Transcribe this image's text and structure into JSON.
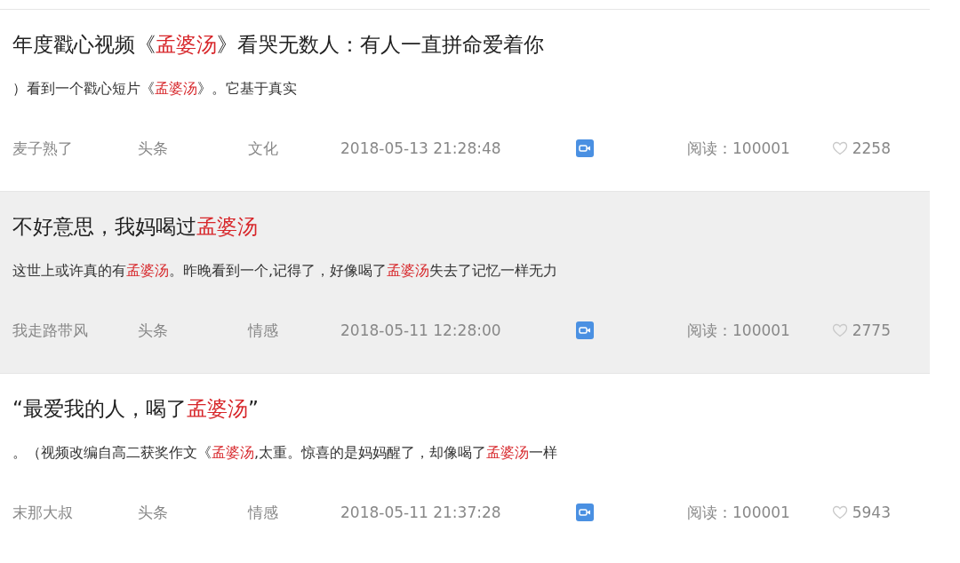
{
  "articles": [
    {
      "highlighted": false,
      "title": [
        {
          "text": "年度戳心视频《",
          "red": false
        },
        {
          "text": "孟婆汤",
          "red": true
        },
        {
          "text": "》看哭无数人：有人一直拼命爱着你",
          "red": false
        }
      ],
      "snippet": [
        {
          "text": "）看到一个戳心短片《",
          "red": false
        },
        {
          "text": "孟婆汤",
          "red": true
        },
        {
          "text": "》。它基于真实",
          "red": false
        }
      ],
      "author": "麦子熟了",
      "source": "头条",
      "category": "文化",
      "time": "2018-05-13 21:28:48",
      "reads": "阅读：100001",
      "likes": "2258"
    },
    {
      "highlighted": true,
      "title": [
        {
          "text": "不好意思，我妈喝过",
          "red": false
        },
        {
          "text": "孟婆汤",
          "red": true
        }
      ],
      "snippet": [
        {
          "text": "这世上或许真的有",
          "red": false
        },
        {
          "text": "孟婆汤",
          "red": true
        },
        {
          "text": "。昨晚看到一个,记得了，好像喝了",
          "red": false
        },
        {
          "text": "孟婆汤",
          "red": true
        },
        {
          "text": "失去了记忆一样无力",
          "red": false
        }
      ],
      "author": "我走路带风",
      "source": "头条",
      "category": "情感",
      "time": "2018-05-11 12:28:00",
      "reads": "阅读：100001",
      "likes": "2775"
    },
    {
      "highlighted": false,
      "title": [
        {
          "text": "“最爱我的人，喝了",
          "red": false
        },
        {
          "text": "孟婆汤",
          "red": true
        },
        {
          "text": "”",
          "red": false
        }
      ],
      "snippet": [
        {
          "text": "。（视频改编自高二获奖作文《",
          "red": false
        },
        {
          "text": "孟婆汤",
          "red": true
        },
        {
          "text": ",太重。惊喜的是妈妈醒了，却像喝了",
          "red": false
        },
        {
          "text": "孟婆汤",
          "red": true
        },
        {
          "text": "一样",
          "red": false
        }
      ],
      "author": "末那大叔",
      "source": "头条",
      "category": "情感",
      "time": "2018-05-11 21:37:28",
      "reads": "阅读：100001",
      "likes": "5943"
    }
  ]
}
